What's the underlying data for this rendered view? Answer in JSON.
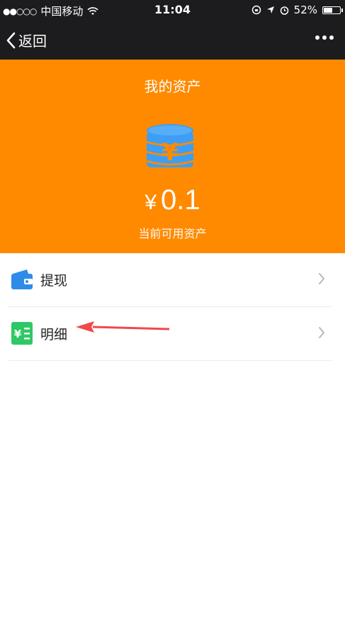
{
  "status_bar": {
    "signal": "●●○○○",
    "carrier": "中国移动",
    "time": "11:04",
    "battery": "52%",
    "battery_level": 0.52
  },
  "nav": {
    "back_label": "返回"
  },
  "assets": {
    "title": "我的资产",
    "currency_symbol": "¥",
    "amount": "0.1",
    "subtitle": "当前可用资产"
  },
  "menu": {
    "items": [
      {
        "label": "提现",
        "icon": "wallet-icon"
      },
      {
        "label": "明细",
        "icon": "ledger-icon"
      }
    ]
  },
  "colors": {
    "header_bg": "#1c1c1e",
    "hero_bg": "#ff8a00",
    "coin": "#3d9ef5",
    "wallet_icon": "#2d8ce8",
    "ledger_icon": "#2ec866",
    "annotation_arrow": "#f2484b"
  }
}
